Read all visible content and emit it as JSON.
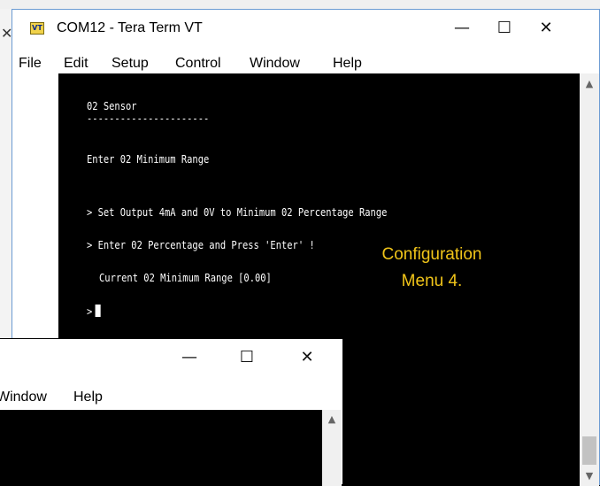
{
  "back_window": {
    "close_glyph": "✕"
  },
  "main_window": {
    "title": "COM12 - Tera Term VT",
    "app_icon_text": "VT",
    "controls": {
      "minimize": "—",
      "maximize": "☐",
      "close": "✕"
    },
    "menu": [
      "File",
      "Edit",
      "Setup",
      "Control",
      "Window",
      "Help"
    ],
    "terminal_lines": [
      "02 Sensor",
      "----------------------",
      "Enter 02 Minimum Range",
      "> Set Output 4mA and 0V to Minimum 02 Percentage Range",
      "> Enter 02 Percentage and Press 'Enter' !",
      "Current 02 Minimum Range [0.00]",
      ">"
    ],
    "scroll_arrows": {
      "up": "▲",
      "down": "▼"
    }
  },
  "annotation": {
    "line1": "Configuration",
    "line2": "Menu 4."
  },
  "front_window": {
    "controls": {
      "minimize": "—",
      "maximize": "☐",
      "close": "✕"
    },
    "menu": [
      "Window",
      "Help"
    ],
    "scroll_up": "▲"
  }
}
